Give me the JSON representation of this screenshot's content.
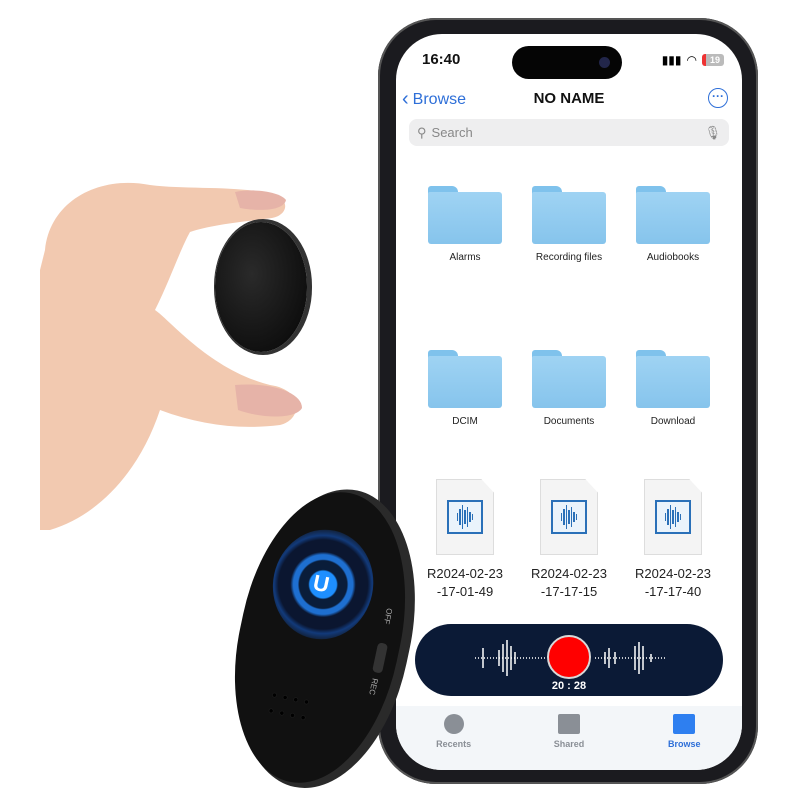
{
  "status_bar": {
    "time": "16:40",
    "battery": "19"
  },
  "nav": {
    "back_label": "Browse",
    "title": "NO NAME"
  },
  "search": {
    "placeholder": "Search"
  },
  "folders": [
    {
      "label": "Alarms"
    },
    {
      "label": "Recording files"
    },
    {
      "label": "Audiobooks"
    },
    {
      "label": "DCIM"
    },
    {
      "label": "Documents"
    },
    {
      "label": "Download"
    }
  ],
  "files": [
    {
      "line1": "R2024-02-23",
      "line2": "-17-01-49"
    },
    {
      "line1": "R2024-02-23",
      "line2": "-17-17-15"
    },
    {
      "line1": "R2024-02-23",
      "line2": "-17-17-40"
    }
  ],
  "recorder": {
    "elapsed": "20 : 28",
    "record_color": "#ff0000"
  },
  "tab_bar": {
    "items": [
      {
        "label": "Recents",
        "icon": "clock-icon"
      },
      {
        "label": "Shared",
        "icon": "shared-folder-icon"
      },
      {
        "label": "Browse",
        "icon": "folder-icon",
        "active": true
      }
    ]
  },
  "device": {
    "switch_off": "OFF",
    "switch_rec": "REC",
    "logo": "U",
    "accent": "#1e8fff"
  },
  "colors": {
    "accent": "#2e6fd8",
    "folder": "#8ec8ee"
  }
}
